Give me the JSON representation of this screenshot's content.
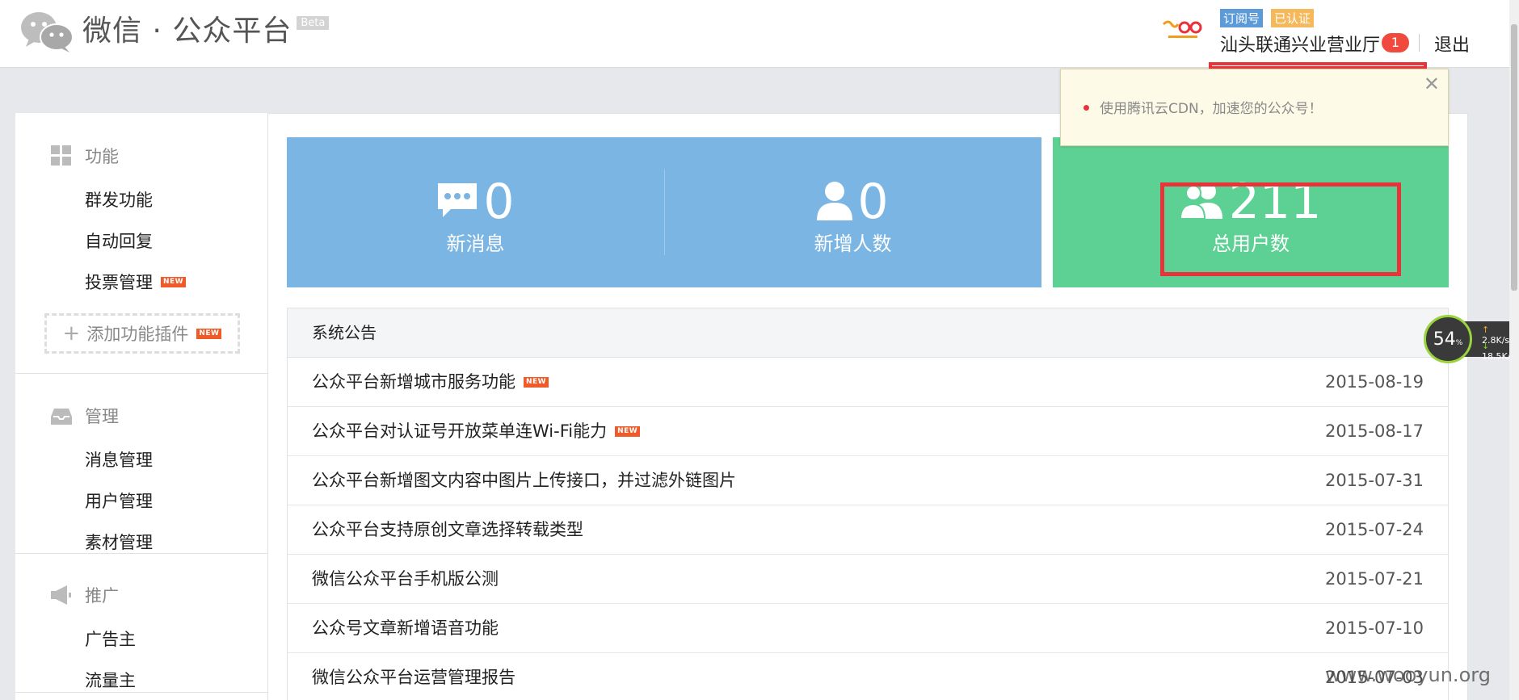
{
  "header": {
    "logo_text": "微信 · 公众平台",
    "beta_label": "Beta",
    "account_type_tag": "订阅号",
    "verified_tag": "已认证",
    "account_name": "汕头联通兴业营业厅",
    "notification_count": "1",
    "logout_label": "退出"
  },
  "notification": {
    "text": "使用腾讯云CDN，加速您的公众号！",
    "close_icon": "✕"
  },
  "sidebar": {
    "sections": [
      {
        "title": "功能",
        "icon": "grid-icon",
        "items": [
          {
            "label": "群发功能",
            "new": false
          },
          {
            "label": "自动回复",
            "new": false
          },
          {
            "label": "投票管理",
            "new": true
          }
        ]
      },
      {
        "title": "管理",
        "icon": "inbox-icon",
        "items": [
          {
            "label": "消息管理"
          },
          {
            "label": "用户管理"
          },
          {
            "label": "素材管理"
          }
        ]
      },
      {
        "title": "推广",
        "icon": "megaphone-icon",
        "items": [
          {
            "label": "广告主"
          },
          {
            "label": "流量主"
          }
        ]
      }
    ],
    "add_plugin": {
      "plus": "+",
      "label": "添加功能插件"
    },
    "new_tag": "NEW"
  },
  "stats": {
    "new_messages": {
      "value": "0",
      "label": "新消息"
    },
    "new_users": {
      "value": "0",
      "label": "新增人数"
    },
    "total_users": {
      "value": "211",
      "label": "总用户数"
    }
  },
  "announcements": {
    "title": "系统公告",
    "rows": [
      {
        "title": "公众平台新增城市服务功能",
        "date": "2015-08-19",
        "new": true
      },
      {
        "title": "公众平台对认证号开放菜单连Wi-Fi能力",
        "date": "2015-08-17",
        "new": true
      },
      {
        "title": "公众平台新增图文内容中图片上传接口，并过滤外链图片",
        "date": "2015-07-31",
        "new": false
      },
      {
        "title": "公众平台支持原创文章选择转载类型",
        "date": "2015-07-24",
        "new": false
      },
      {
        "title": "微信公众平台手机版公测",
        "date": "2015-07-21",
        "new": false
      },
      {
        "title": "公众号文章新增语音功能",
        "date": "2015-07-10",
        "new": false
      },
      {
        "title": "微信公众平台运营管理报告",
        "date": "2015-07-03",
        "new": false
      }
    ]
  },
  "speed_widget": {
    "percent": "54",
    "percent_sign": "%",
    "up_rate": "2.8",
    "down_rate": "18.5",
    "unit": "K/s"
  },
  "watermark": "www.wooyun.org",
  "colors": {
    "blue_panel": "#7ab5e3",
    "green_panel": "#5dd193",
    "highlight_red": "#e8333a",
    "new_tag": "#f05a28"
  }
}
